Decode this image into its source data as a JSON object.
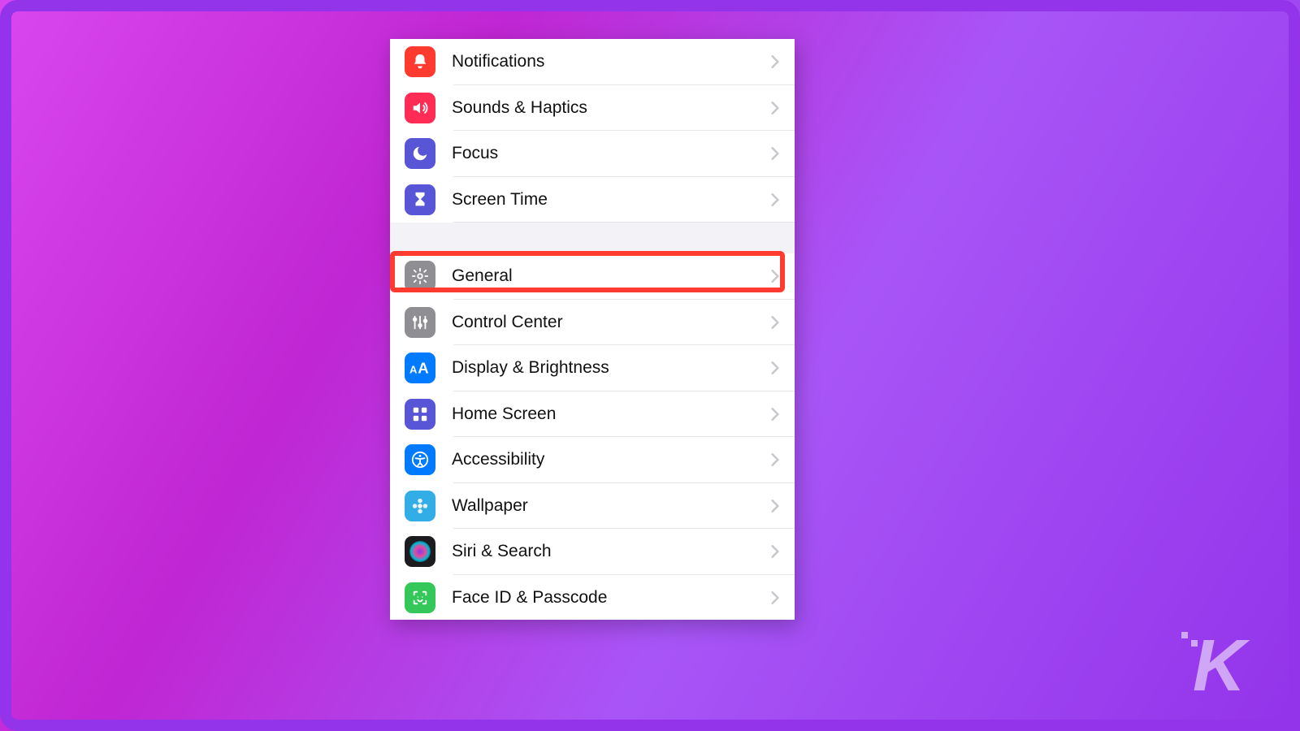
{
  "groups": [
    {
      "rows": [
        {
          "id": "notifications",
          "label": "Notifications",
          "icon": "bell-icon",
          "color": "ic-red"
        },
        {
          "id": "sounds",
          "label": "Sounds & Haptics",
          "icon": "speaker-icon",
          "color": "ic-red2"
        },
        {
          "id": "focus",
          "label": "Focus",
          "icon": "moon-icon",
          "color": "ic-indigo"
        },
        {
          "id": "screentime",
          "label": "Screen Time",
          "icon": "hourglass-icon",
          "color": "ic-indigo"
        }
      ]
    },
    {
      "rows": [
        {
          "id": "general",
          "label": "General",
          "icon": "gear-icon",
          "color": "ic-gray",
          "highlighted": true
        },
        {
          "id": "control-center",
          "label": "Control Center",
          "icon": "sliders-icon",
          "color": "ic-gray"
        },
        {
          "id": "display",
          "label": "Display & Brightness",
          "icon": "text-size-icon",
          "color": "ic-blue"
        },
        {
          "id": "home-screen",
          "label": "Home Screen",
          "icon": "grid-icon",
          "color": "ic-indigo"
        },
        {
          "id": "accessibility",
          "label": "Accessibility",
          "icon": "accessibility-icon",
          "color": "ic-blue"
        },
        {
          "id": "wallpaper",
          "label": "Wallpaper",
          "icon": "flower-icon",
          "color": "ic-cyan"
        },
        {
          "id": "siri",
          "label": "Siri & Search",
          "icon": "siri-icon",
          "color": "ic-dark"
        },
        {
          "id": "faceid",
          "label": "Face ID & Passcode",
          "icon": "face-id-icon",
          "color": "ic-green"
        }
      ]
    }
  ],
  "highlight_color": "#ff3b30",
  "watermark": "K"
}
